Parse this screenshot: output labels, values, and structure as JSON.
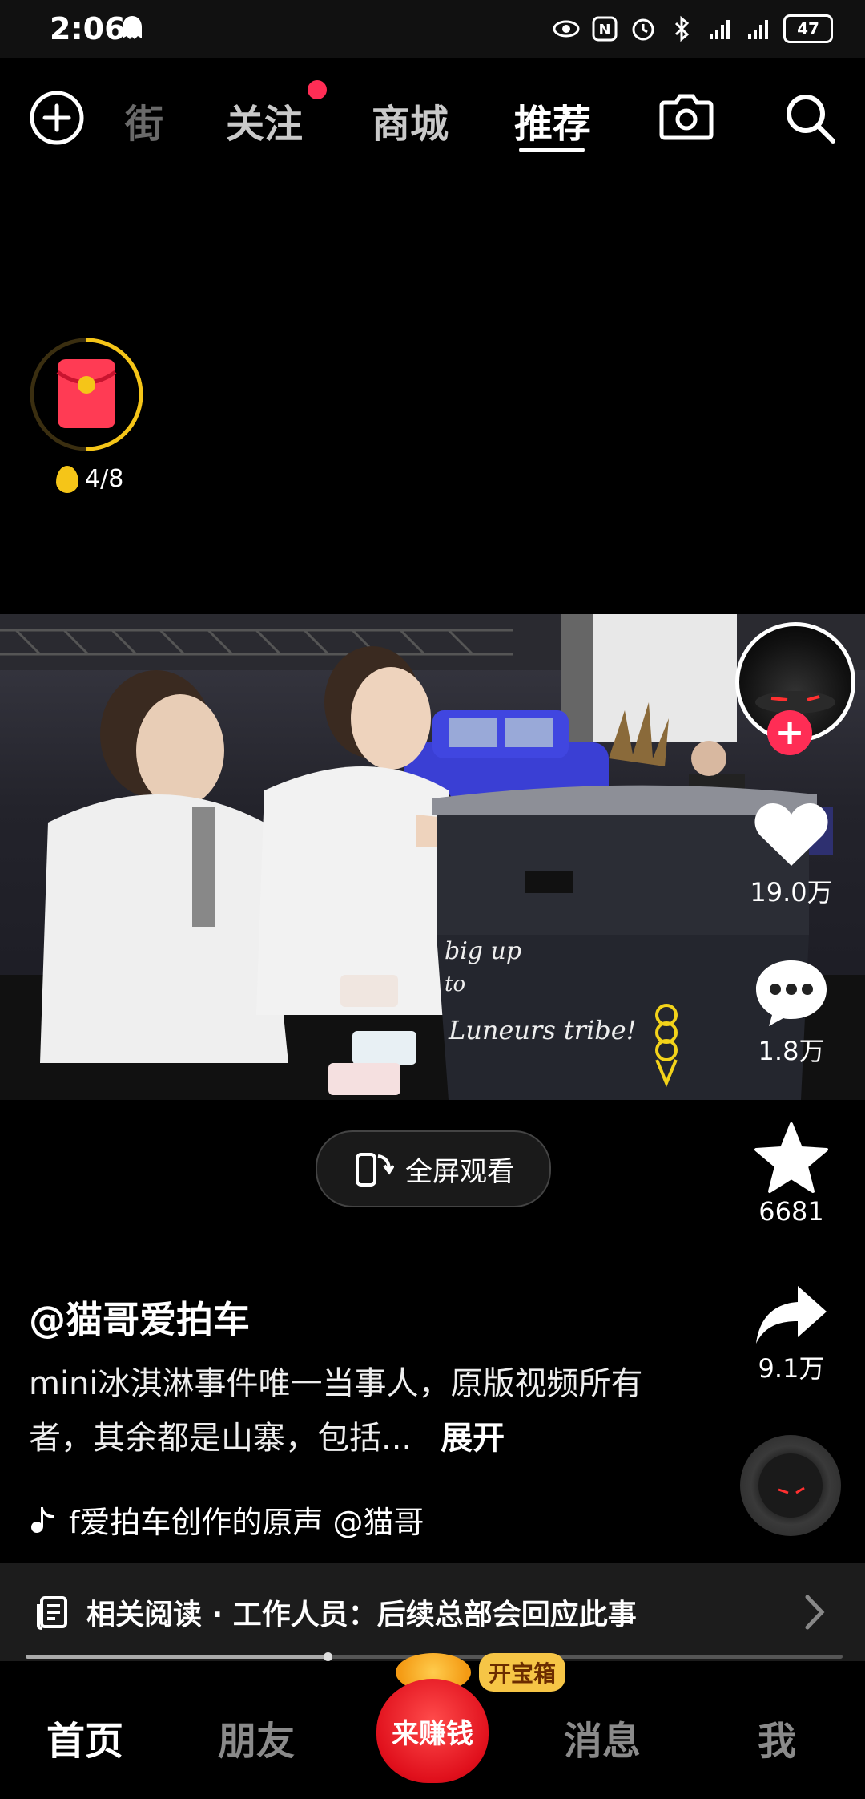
{
  "status_bar": {
    "time": "2:06",
    "battery": "47",
    "icons": [
      "ghost-icon",
      "eye-icon",
      "nfc-icon",
      "alarm-icon",
      "bluetooth-icon",
      "signal-4g-icon",
      "signal-4g-icon"
    ]
  },
  "top_nav": {
    "tabs": [
      {
        "label": "街",
        "state": "dim"
      },
      {
        "label": "关注",
        "state": "normal",
        "badge": true
      },
      {
        "label": "商城",
        "state": "normal"
      },
      {
        "label": "推荐",
        "state": "active"
      }
    ],
    "icons": [
      "plus-circle-icon",
      "camera-icon",
      "search-icon"
    ]
  },
  "red_packet": {
    "progress_text": "4/8",
    "progress_fraction": 0.5
  },
  "video": {
    "overlay_text": [
      "big up",
      "to",
      "Luneurs tribe!"
    ]
  },
  "fullscreen": {
    "label": "全屏观看"
  },
  "actions": {
    "likes": "19.0万",
    "comments": "1.8万",
    "favorites": "6681",
    "shares": "9.1万"
  },
  "caption": {
    "author": "@猫哥爱拍车",
    "description": "mini冰淇淋事件唯一当事人，原版视频所有者，其余都是山寨，包括...",
    "more_label": "展开",
    "music": "f爱拍车创作的原声    @猫哥"
  },
  "related": {
    "text": "相关阅读 · 工作人员：后续总部会回应此事"
  },
  "playback": {
    "progress_fraction": 0.37
  },
  "bottom_tabs": [
    {
      "label": "首页",
      "active": true
    },
    {
      "label": "朋友",
      "active": false
    },
    {
      "label": "消息",
      "active": false
    },
    {
      "label": "我",
      "active": false
    }
  ],
  "earn": {
    "label": "来赚钱",
    "badge": "开宝箱"
  },
  "colors": {
    "accent_red": "#ff2d55",
    "ring_gold": "#f5c518"
  }
}
